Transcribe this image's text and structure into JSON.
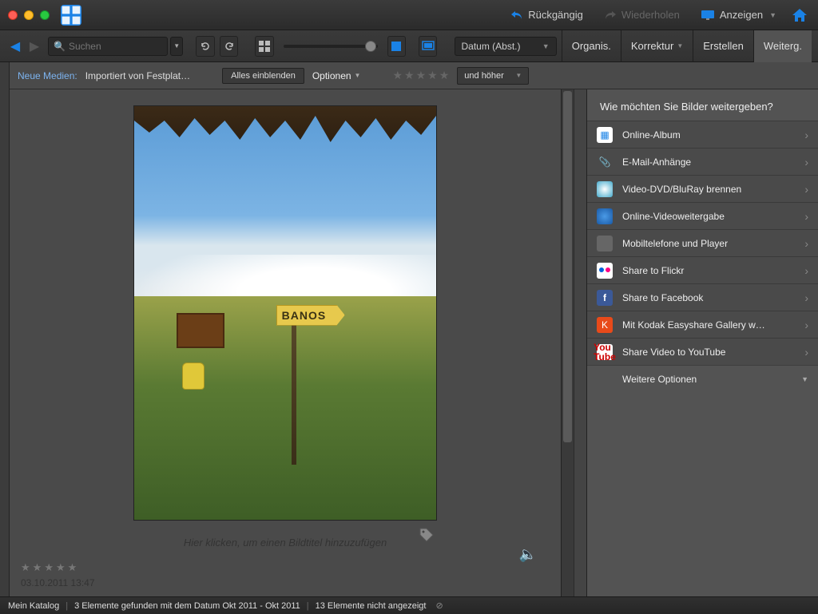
{
  "titlebar": {
    "undo": "Rückgängig",
    "redo": "Wiederholen",
    "display": "Anzeigen"
  },
  "toolbar": {
    "search_placeholder": "Suchen",
    "sort": "Datum (Abst.)",
    "tabs": {
      "organize": "Organis.",
      "correct": "Korrektur",
      "create": "Erstellen",
      "share": "Weiterg."
    }
  },
  "subbar": {
    "label": "Neue Medien:",
    "text": "Importiert von Festplat…",
    "show_all": "Alles einblenden",
    "options": "Optionen",
    "rating_filter": "und höher"
  },
  "viewer": {
    "sign_text": "BANOS",
    "caption": "Hier klicken, um einen Bildtitel hinzuzufügen",
    "date": "03.10.2011 13:47"
  },
  "panel": {
    "heading": "Wie möchten Sie Bilder weitergeben?",
    "items": [
      {
        "label": "Online-Album",
        "ic": "album"
      },
      {
        "label": "E-Mail-Anhänge",
        "ic": "mail"
      },
      {
        "label": "Video-DVD/BluRay brennen",
        "ic": "dvd"
      },
      {
        "label": "Online-Videoweitergabe",
        "ic": "globe"
      },
      {
        "label": "Mobiltelefone und Player",
        "ic": "phone"
      },
      {
        "label": "Share to Flickr",
        "ic": "flickr"
      },
      {
        "label": "Share to Facebook",
        "ic": "fb"
      },
      {
        "label": "Mit Kodak Easyshare Gallery w…",
        "ic": "kodak"
      },
      {
        "label": "Share Video to YouTube",
        "ic": "yt"
      }
    ],
    "more": "Weitere Optionen"
  },
  "status": {
    "catalog": "Mein Katalog",
    "found": "3 Elemente gefunden mit dem Datum Okt 2011 - Okt 2011",
    "hidden": "13 Elemente nicht angezeigt"
  }
}
